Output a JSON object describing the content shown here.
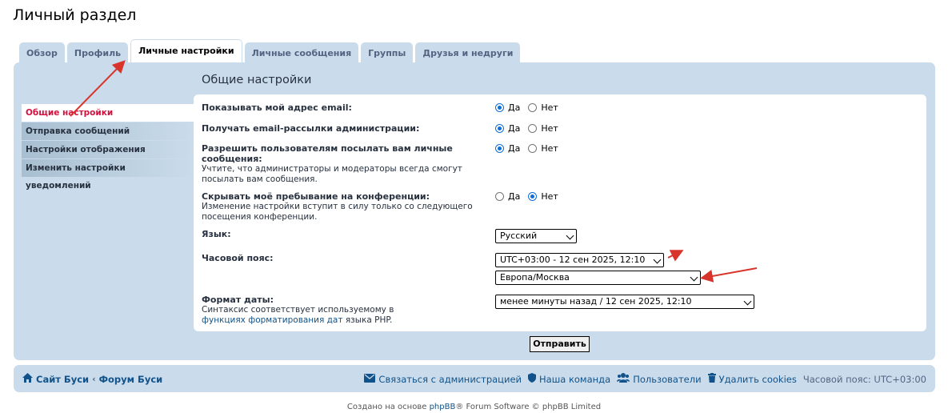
{
  "page": {
    "title": "Личный раздел"
  },
  "tabs": [
    {
      "label": "Обзор"
    },
    {
      "label": "Профиль"
    },
    {
      "label": "Личные настройки"
    },
    {
      "label": "Личные сообщения"
    },
    {
      "label": "Группы"
    },
    {
      "label": "Друзья и недруги"
    }
  ],
  "menu": [
    {
      "label": "Общие настройки"
    },
    {
      "label": "Отправка сообщений"
    },
    {
      "label": "Настройки отображения"
    },
    {
      "label": "Изменить настройки уведомлений"
    }
  ],
  "section_title": "Общие настройки",
  "settings": {
    "show_email": {
      "label": "Показывать мой адрес email:",
      "yes": "Да",
      "no": "Нет",
      "value": "yes"
    },
    "mass_email": {
      "label": "Получать email-рассылки администрации:",
      "yes": "Да",
      "no": "Нет",
      "value": "yes"
    },
    "allow_pm": {
      "label": "Разрешить пользователям посылать вам личные сообщения:",
      "explain": "Учтите, что администраторы и модераторы всегда смогут посылать вам сообщения.",
      "yes": "Да",
      "no": "Нет",
      "value": "yes"
    },
    "hide_online": {
      "label": "Скрывать моё пребывание на конференции:",
      "explain": "Изменение настройки вступит в силу только со следующего посещения конференции.",
      "yes": "Да",
      "no": "Нет",
      "value": "no"
    },
    "language": {
      "label": "Язык:",
      "selected": "Русский"
    },
    "timezone": {
      "label": "Часовой пояс:",
      "selected_offset": "UTC+03:00 - 12 сен 2025, 12:10",
      "selected_zone": "Европа/Москва"
    },
    "date_format": {
      "label": "Формат даты:",
      "explain_pre": "Синтаксис соответствует используемому в",
      "explain_link": "функциях форматирования дат",
      "explain_post": "языка PHP.",
      "selected": "менее минуты назад / 12 сен 2025, 12:10"
    }
  },
  "submit_label": "Отправить",
  "footer": {
    "site": "Сайт Буси",
    "forum": "Форум Буси",
    "contact": "Связаться с администрацией",
    "team": "Наша команда",
    "members": "Пользователи",
    "delete_cookies": "Удалить cookies",
    "timezone": "Часовой пояс: UTC+03:00"
  },
  "copyright": {
    "pre": "Создано на основе",
    "link": "phpBB",
    "post": "® Forum Software © phpBB Limited"
  },
  "colors": {
    "accent": "#d31141",
    "panel": "#cadceb",
    "link": "#105289",
    "annotation": "#d9342b"
  }
}
